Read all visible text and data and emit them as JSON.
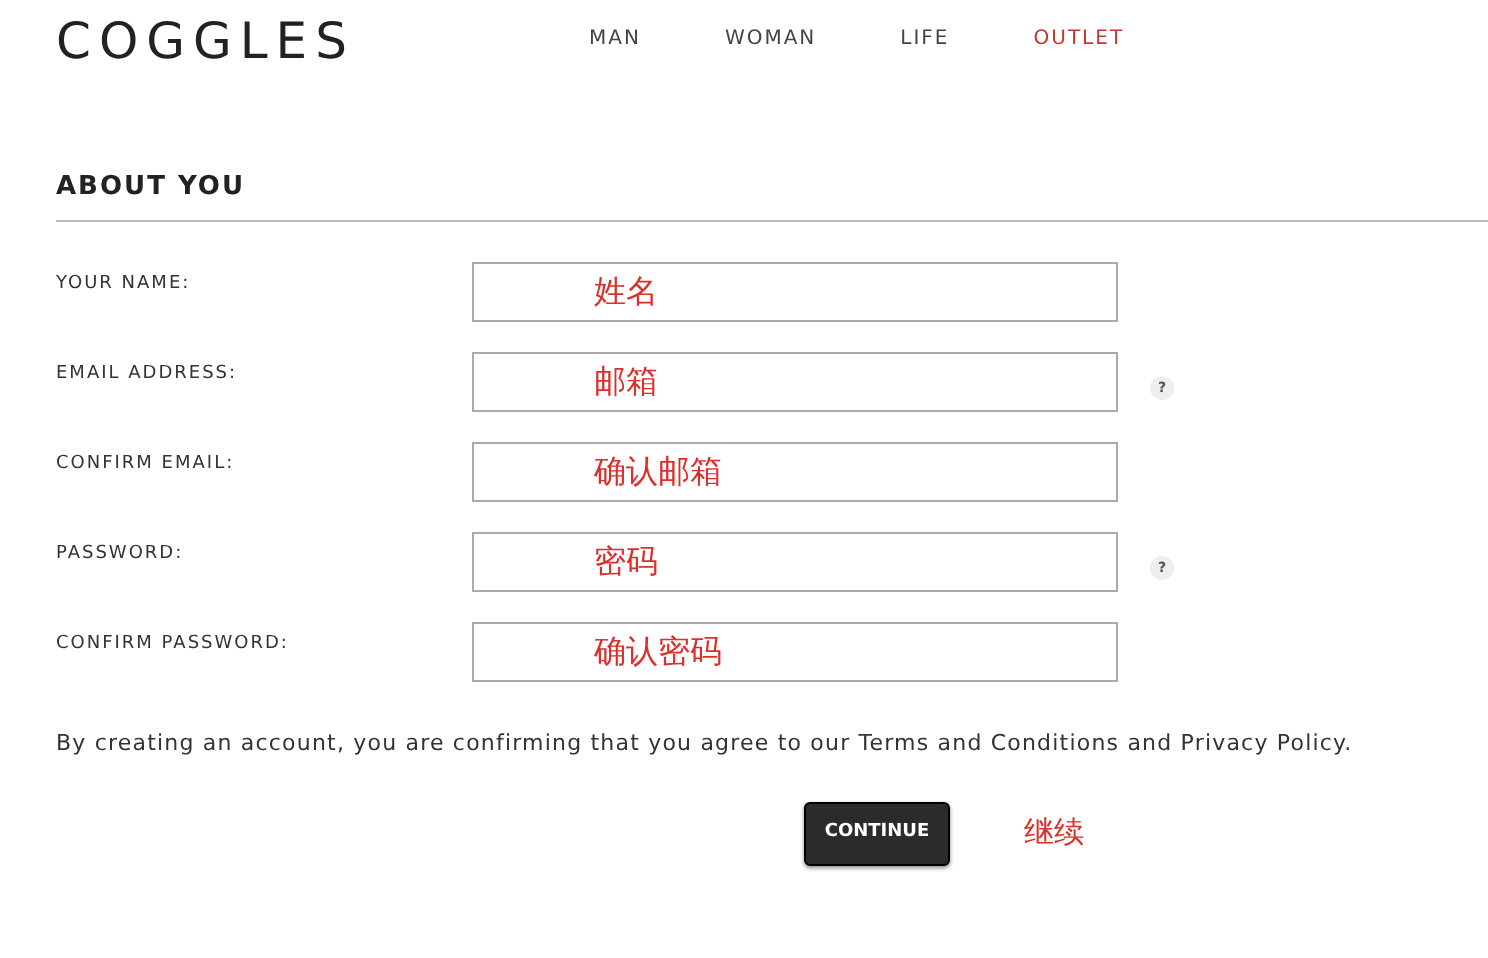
{
  "logo": "COGGLES",
  "nav": [
    {
      "label": "MAN",
      "selected": false
    },
    {
      "label": "WOMAN",
      "selected": false
    },
    {
      "label": "LIFE",
      "selected": false
    },
    {
      "label": "OUTLET",
      "selected": true
    }
  ],
  "section_title": "ABOUT YOU",
  "fields": [
    {
      "label": "YOUR NAME:",
      "value": "姓名",
      "help": false
    },
    {
      "label": "EMAIL ADDRESS:",
      "value": "邮箱",
      "help": true
    },
    {
      "label": "CONFIRM EMAIL:",
      "value": "确认邮箱",
      "help": false
    },
    {
      "label": "PASSWORD:",
      "value": "密码",
      "help": true
    },
    {
      "label": "CONFIRM PASSWORD:",
      "value": "确认密码",
      "help": false
    }
  ],
  "help_icon": "?",
  "terms": "By creating an account, you are confirming that you agree to our Terms and Conditions and Privacy Policy.",
  "continue_button": "CONTINUE",
  "continue_note": "继续"
}
